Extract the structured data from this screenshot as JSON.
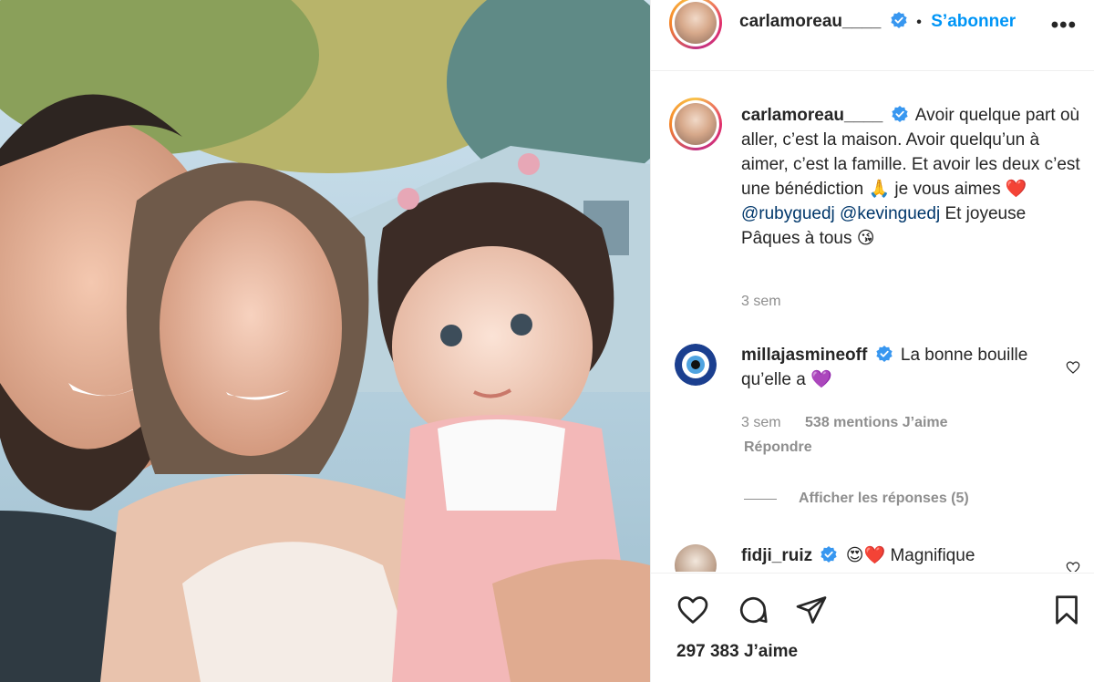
{
  "header": {
    "username": "carlamoreau____",
    "dot": "•",
    "follow_label": "S’abonner",
    "more_label": "•••",
    "icons": [
      "verified-badge-icon",
      "more-options-icon"
    ]
  },
  "caption": {
    "username": "carlamoreau____",
    "text_1": "Avoir quelque part où aller, c’est la maison. Avoir quelqu’un à aimer, c’est la famille. Et avoir les deux c’est une bénédiction",
    "emoji_pray": "🙏",
    "text_2": "je vous aimes",
    "emoji_heart": "❤️",
    "mention_1": "@rubyguedj",
    "mention_2": "@kevinguedj",
    "text_3": "Et joyeuse Pâques à tous",
    "emoji_kiss": "😘",
    "time": "3 sem"
  },
  "comment_1": {
    "username": "millajasmineoff",
    "text": "La bonne bouille qu’elle a",
    "emoji": "💜",
    "time": "3 sem",
    "likes": "538 mentions J’aime",
    "reply_label": "Répondre",
    "view_replies": "Afficher les réponses (5)"
  },
  "comment_2": {
    "username": "fidji_ruiz",
    "emoji": "😍❤️",
    "text": "Magnifique"
  },
  "footer": {
    "likes": "297 383 J’aime",
    "icons": [
      "like-icon",
      "comment-icon",
      "share-icon",
      "save-icon"
    ]
  },
  "colors": {
    "accent": "#0095f6",
    "verified": "#3897f0",
    "text": "#262626",
    "muted": "#8e8e8e",
    "mention": "#00376b",
    "border": "#efefef"
  }
}
